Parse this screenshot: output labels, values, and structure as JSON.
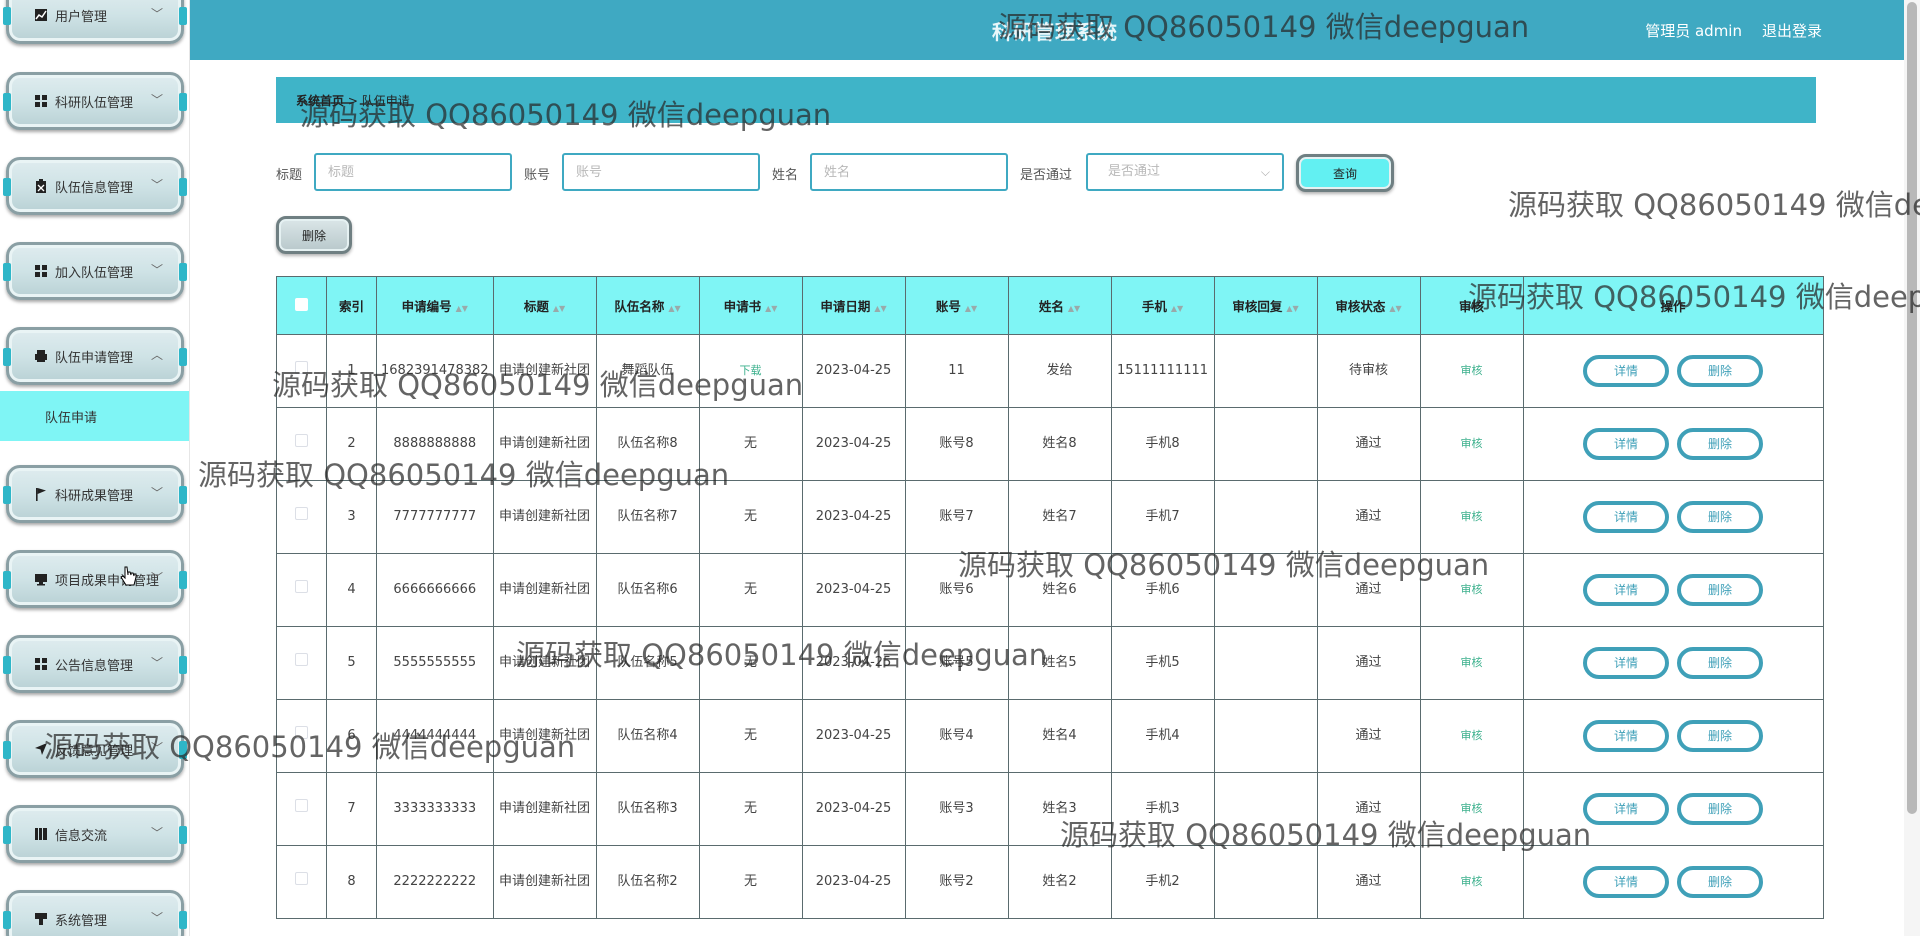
{
  "sidebar": {
    "items": [
      {
        "label": "用户管理",
        "icon": "chart-icon",
        "expanded": false
      },
      {
        "label": "科研队伍管理",
        "icon": "grid-icon",
        "expanded": false
      },
      {
        "label": "队伍信息管理",
        "icon": "clipboard-icon",
        "expanded": false
      },
      {
        "label": "加入队伍管理",
        "icon": "grid-icon",
        "expanded": false
      },
      {
        "label": "队伍申请管理",
        "icon": "printer-icon",
        "expanded": true
      },
      {
        "label": "科研成果管理",
        "icon": "flag-icon",
        "expanded": false
      },
      {
        "label": "项目成果申请管理",
        "icon": "monitor-icon",
        "expanded": false
      },
      {
        "label": "公告信息管理",
        "icon": "grid-icon",
        "expanded": false
      },
      {
        "label": "反馈意见管理",
        "icon": "send-icon",
        "expanded": false
      },
      {
        "label": "信息交流",
        "icon": "book-icon",
        "expanded": false
      },
      {
        "label": "系统管理",
        "icon": "bookmark-icon",
        "expanded": false
      }
    ],
    "submenu_active": "队伍申请"
  },
  "header": {
    "title": "科研管理系统",
    "admin_text": "管理员 admin",
    "logout": "退出登录"
  },
  "breadcrumb": {
    "home": "系统首页",
    "separator": " > ",
    "current": "队伍申请"
  },
  "search": {
    "title_label": "标题",
    "title_placeholder": "标题",
    "account_label": "账号",
    "account_placeholder": "账号",
    "name_label": "姓名",
    "name_placeholder": "姓名",
    "status_label": "是否通过",
    "status_placeholder": "是否通过",
    "query_button": "查询"
  },
  "toolbar": {
    "delete_button": "删除"
  },
  "table": {
    "headers": {
      "index": "索引",
      "app_no": "申请编号",
      "title": "标题",
      "team_name": "队伍名称",
      "application": "申请书",
      "app_date": "申请日期",
      "account": "账号",
      "name": "姓名",
      "phone": "手机",
      "review_reply": "审核回复",
      "review_status": "审核状态",
      "review": "审核",
      "actions": "操作"
    },
    "rows": [
      {
        "index": "1",
        "app_no": "1682391478382",
        "title": "申请创建新社团",
        "team": "舞蹈队伍",
        "application": "下载",
        "date": "2023-04-25",
        "account": "11",
        "name": "发给",
        "phone": "15111111111",
        "reply": "",
        "status": "待审核",
        "review": "审核",
        "detail": "详情",
        "delete": "删除"
      },
      {
        "index": "2",
        "app_no": "8888888888",
        "title": "申请创建新社团",
        "team": "队伍名称8",
        "application": "无",
        "date": "2023-04-25",
        "account": "账号8",
        "name": "姓名8",
        "phone": "手机8",
        "reply": "",
        "status": "通过",
        "review": "审核",
        "detail": "详情",
        "delete": "删除"
      },
      {
        "index": "3",
        "app_no": "7777777777",
        "title": "申请创建新社团",
        "team": "队伍名称7",
        "application": "无",
        "date": "2023-04-25",
        "account": "账号7",
        "name": "姓名7",
        "phone": "手机7",
        "reply": "",
        "status": "通过",
        "review": "审核",
        "detail": "详情",
        "delete": "删除"
      },
      {
        "index": "4",
        "app_no": "6666666666",
        "title": "申请创建新社团",
        "team": "队伍名称6",
        "application": "无",
        "date": "2023-04-25",
        "account": "账号6",
        "name": "姓名6",
        "phone": "手机6",
        "reply": "",
        "status": "通过",
        "review": "审核",
        "detail": "详情",
        "delete": "删除"
      },
      {
        "index": "5",
        "app_no": "5555555555",
        "title": "申请创建新社团",
        "team": "队伍名称5",
        "application": "无",
        "date": "2023-04-25",
        "account": "账号5",
        "name": "姓名5",
        "phone": "手机5",
        "reply": "",
        "status": "通过",
        "review": "审核",
        "detail": "详情",
        "delete": "删除"
      },
      {
        "index": "6",
        "app_no": "4444444444",
        "title": "申请创建新社团",
        "team": "队伍名称4",
        "application": "无",
        "date": "2023-04-25",
        "account": "账号4",
        "name": "姓名4",
        "phone": "手机4",
        "reply": "",
        "status": "通过",
        "review": "审核",
        "detail": "详情",
        "delete": "删除"
      },
      {
        "index": "7",
        "app_no": "3333333333",
        "title": "申请创建新社团",
        "team": "队伍名称3",
        "application": "无",
        "date": "2023-04-25",
        "account": "账号3",
        "name": "姓名3",
        "phone": "手机3",
        "reply": "",
        "status": "通过",
        "review": "审核",
        "detail": "详情",
        "delete": "删除"
      },
      {
        "index": "8",
        "app_no": "2222222222",
        "title": "申请创建新社团",
        "team": "队伍名称2",
        "application": "无",
        "date": "2023-04-25",
        "account": "账号2",
        "name": "姓名2",
        "phone": "手机2",
        "reply": "",
        "status": "通过",
        "review": "审核",
        "detail": "详情",
        "delete": "删除"
      }
    ]
  },
  "watermark_text": "源码获取 QQ86050149 微信deepguan",
  "colors": {
    "primary": "#3fa9c2",
    "accent_cyan": "#7ff5f5",
    "link_green": "#3bb08c"
  }
}
